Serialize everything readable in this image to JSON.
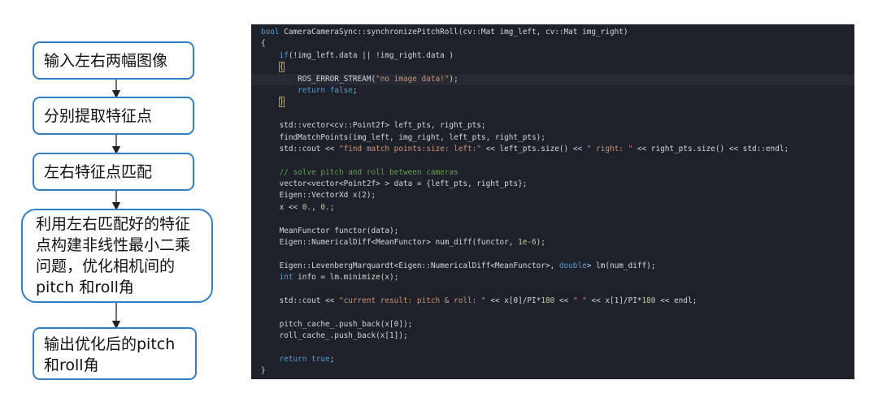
{
  "flowchart": {
    "steps": [
      "输入左右两幅图像",
      "分别提取特征点",
      "左右特征点匹配",
      "利用左右匹配好的特征\n点构建非线性最小二乘\n问题，优化相机间的\npitch 和roll角",
      "输出优化后的pitch\n和roll角"
    ]
  },
  "code": {
    "lines": [
      "bool CameraCameraSync::synchronizePitchRoll(cv::Mat img_left, cv::Mat img_right)",
      "{",
      "    if(!img_left.data || !img_right.data )",
      "    {",
      "        ROS_ERROR_STREAM(\"no image data!\");",
      "        return false;",
      "    }",
      "",
      "    std::vector<cv::Point2f> left_pts, right_pts;",
      "    findMatchPoints(img_left, img_right, left_pts, right_pts);",
      "    std::cout << \"find match points:size: left:\" << left_pts.size() << \" right: \" << right_pts.size() << std::endl;",
      "",
      "    // solve pitch and roll between cameras",
      "    vector<vector<Point2f> > data = {left_pts, right_pts};",
      "    Eigen::VectorXd x(2);",
      "    x << 0., 0.;",
      "",
      "    MeanFunctor functor(data);",
      "    Eigen::NumericalDiff<MeanFunctor> num_diff(functor, 1e-6);",
      "",
      "    Eigen::LevenbergMarquardt<Eigen::NumericalDiff<MeanFunctor>, double> lm(num_diff);",
      "    int info = lm.minimize(x);",
      "",
      "    std::cout << \"current result: pitch & roll: \" << x[0]/PI*180 << \" \" << x[1]/PI*180 << endl;",
      "",
      "    pitch_cache_.push_back(x[0]);",
      "    roll_cache_.push_back(x[1]);",
      "",
      "    return true;",
      "}"
    ]
  }
}
